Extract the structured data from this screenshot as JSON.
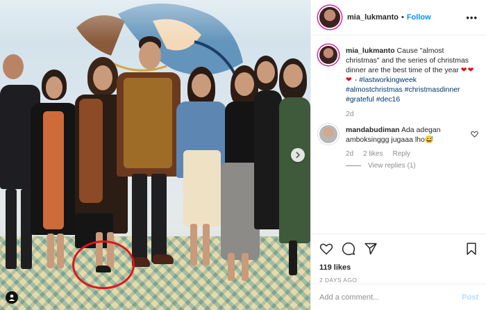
{
  "post": {
    "username": "mia_lukmanto",
    "follow_label": "Follow",
    "more_label": "•••",
    "caption_user": "mia_lukmanto",
    "caption_text": "Cause \"almost christmas\" and the series of christmas dinner are the best time of the year",
    "caption_hearts": "❤❤❤",
    "caption_dash": " - ",
    "hashtags_line1": "#lastworkingweek",
    "hashtags_line2": "#almostchristmas #christmasdinner",
    "hashtags_line3": "#grateful #dec16",
    "caption_age": "2d"
  },
  "comment": {
    "username": "mandabudiman",
    "text": "Ada adegan amboksinggg jugaaa lho😅",
    "age": "2d",
    "likes": "2 likes",
    "reply_label": "Reply",
    "view_replies": "View replies (1)"
  },
  "actions": {
    "likes": "119 likes",
    "posted_ago": "2 DAYS AGO"
  },
  "add_comment": {
    "placeholder": "Add a comment...",
    "post_label": "Post"
  },
  "colors": {
    "accent": "#0095f6",
    "highlight_circle": "#e0141b",
    "hashtag": "#00376b"
  }
}
